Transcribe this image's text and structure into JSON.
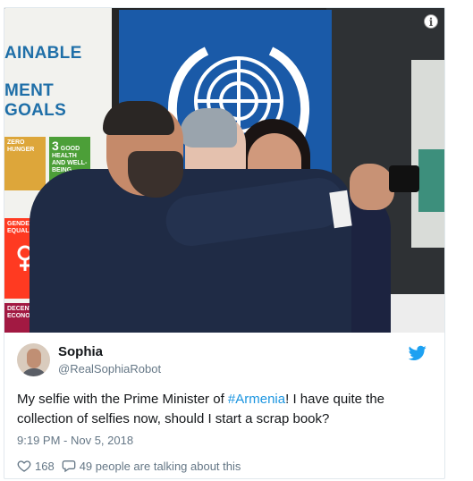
{
  "photo": {
    "banner_line1": "AINABLE",
    "banner_line2": "MENT GOALS",
    "sdg_tiles": [
      {
        "num": "",
        "label": "ZERO HUNGER",
        "color": "#dda63a"
      },
      {
        "num": "3",
        "label": "GOOD HEALTH AND WELL-BEING",
        "color": "#4c9f38"
      },
      {
        "num": "",
        "label": "GENDER EQUALITY",
        "color": "#ff3a21"
      },
      {
        "num": "",
        "label": "DECENT W ECONOMI",
        "color": "#a21942"
      }
    ],
    "info_icon_glyph": "i"
  },
  "tweet": {
    "display_name": "Sophia",
    "handle": "@RealSophiaRobot",
    "text_before": "My selfie with the Prime Minister of ",
    "hashtag": "#Armenia",
    "text_after": "! I have quite the collection of selfies now, should I start a scrap book?",
    "timestamp": "9:19 PM - Nov 5, 2018",
    "like_count": "168",
    "talking_text": "49 people are talking about this",
    "accent_color": "#1b95e0"
  }
}
